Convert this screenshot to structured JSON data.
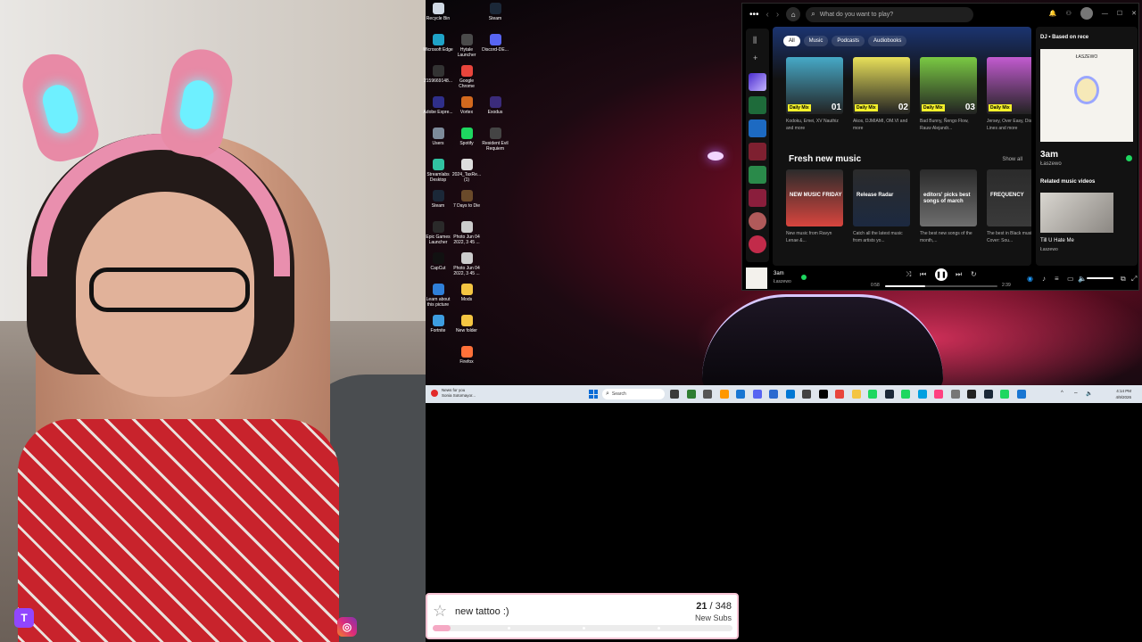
{
  "desktop_icons": [
    {
      "label": "Recycle Bin",
      "color": "#cfd8e3"
    },
    {
      "label": "Steam",
      "color": "#1b2838"
    },
    {
      "label": "Microsoft Edge",
      "color": "#1fa3c7"
    },
    {
      "label": "Hytale Launcher",
      "color": "#4a4a4a"
    },
    {
      "label": "Discord-DE...",
      "color": "#5865f2"
    },
    {
      "label": "2159669148...",
      "color": "#333333"
    },
    {
      "label": "Google Chrome",
      "color": "#e8453c"
    },
    {
      "label": "Adobe Expre...",
      "color": "#2f2f8a"
    },
    {
      "label": "Vortex",
      "color": "#d2691e"
    },
    {
      "label": "Exodus",
      "color": "#3b2b7a"
    },
    {
      "label": "Users",
      "color": "#7d8b9a"
    },
    {
      "label": "Spotify",
      "color": "#1ed760"
    },
    {
      "label": "Resident Evil Requiem",
      "color": "#444444"
    },
    {
      "label": "Streamlabs Desktop",
      "color": "#31c3a2"
    },
    {
      "label": "2024_TaxRe... (1)",
      "color": "#dddddd"
    },
    {
      "label": "Steam",
      "color": "#1b2838"
    },
    {
      "label": "7 Days to Die",
      "color": "#6a4a2a"
    },
    {
      "label": "Epic Games Launcher",
      "color": "#2a2a2a"
    },
    {
      "label": "Photo Jun 04 2022, 3 45 ...",
      "color": "#cccccc"
    },
    {
      "label": "CapCut",
      "color": "#111111"
    },
    {
      "label": "Photo Jun 04 2022, 3 45 ...",
      "color": "#cccccc"
    },
    {
      "label": "Learn about this picture",
      "color": "#2f7fd8"
    },
    {
      "label": "Mods",
      "color": "#f4c542"
    },
    {
      "label": "Fortnite",
      "color": "#3d9de0"
    },
    {
      "label": "New folder",
      "color": "#f4c542"
    },
    {
      "label": "Firefox",
      "color": "#ff7139"
    }
  ],
  "spotify": {
    "search_placeholder": "What do you want to play?",
    "chips": [
      "All",
      "Music",
      "Podcasts",
      "Audiobooks"
    ],
    "daily_mixes": [
      {
        "tag": "Daily Mix",
        "num": "01",
        "desc": "Kodoku, Emei, XV Nauthiz and more",
        "color": "#46a9c7"
      },
      {
        "tag": "Daily Mix",
        "num": "02",
        "desc": "Akos, DJMIAMI, OM.VI and more",
        "color": "#e8e05a"
      },
      {
        "tag": "Daily Mix",
        "num": "03",
        "desc": "Bad Bunny, Ñengo Flow, Rauw Alejandr...",
        "color": "#7ac943"
      },
      {
        "tag": "Daily Mix",
        "num": "04",
        "desc": "Jersey, Over Easy, Disco Lines and more",
        "color": "#c25bd0"
      }
    ],
    "fresh_title": "Fresh new music",
    "show_all": "Show all",
    "fresh": [
      {
        "cap": "NEW MUSIC FRIDAY",
        "desc": "New music from Ravyn Lenae &...",
        "color": "#d8453e"
      },
      {
        "cap": "Release Radar",
        "desc": "Catch all the latest music from artists yo...",
        "color": "#1c2940"
      },
      {
        "cap": "editors' picks best songs of march",
        "desc": "The best new songs of the month,...",
        "color": "#6e6e6e"
      },
      {
        "cap": "FREQUENCY",
        "desc": "The best in Black music! Cover: Sou...",
        "color": "#3a3a3a"
      }
    ],
    "right": {
      "header": "DJ • Based on rece",
      "cover_label": "ŁASZEWO",
      "song": "3am",
      "artist": "Łaszewo",
      "related": "Related music videos",
      "video_title": "Till U Hate Me",
      "video_artist": "Łaszewo"
    },
    "player": {
      "title": "3am",
      "artist": "Łaszewo",
      "elapsed": "0:58",
      "duration": "2:39",
      "progress": 0.36
    }
  },
  "taskbar": {
    "news_line1": "News for you",
    "news_line2": "Sonia Sotomayor...",
    "search": "Search",
    "time": "4:14 PM",
    "date": "4/9/2026"
  },
  "goal": {
    "title": "new tattoo :)",
    "current": "21",
    "target": "348",
    "label": "New Subs",
    "fraction": 0.06
  }
}
